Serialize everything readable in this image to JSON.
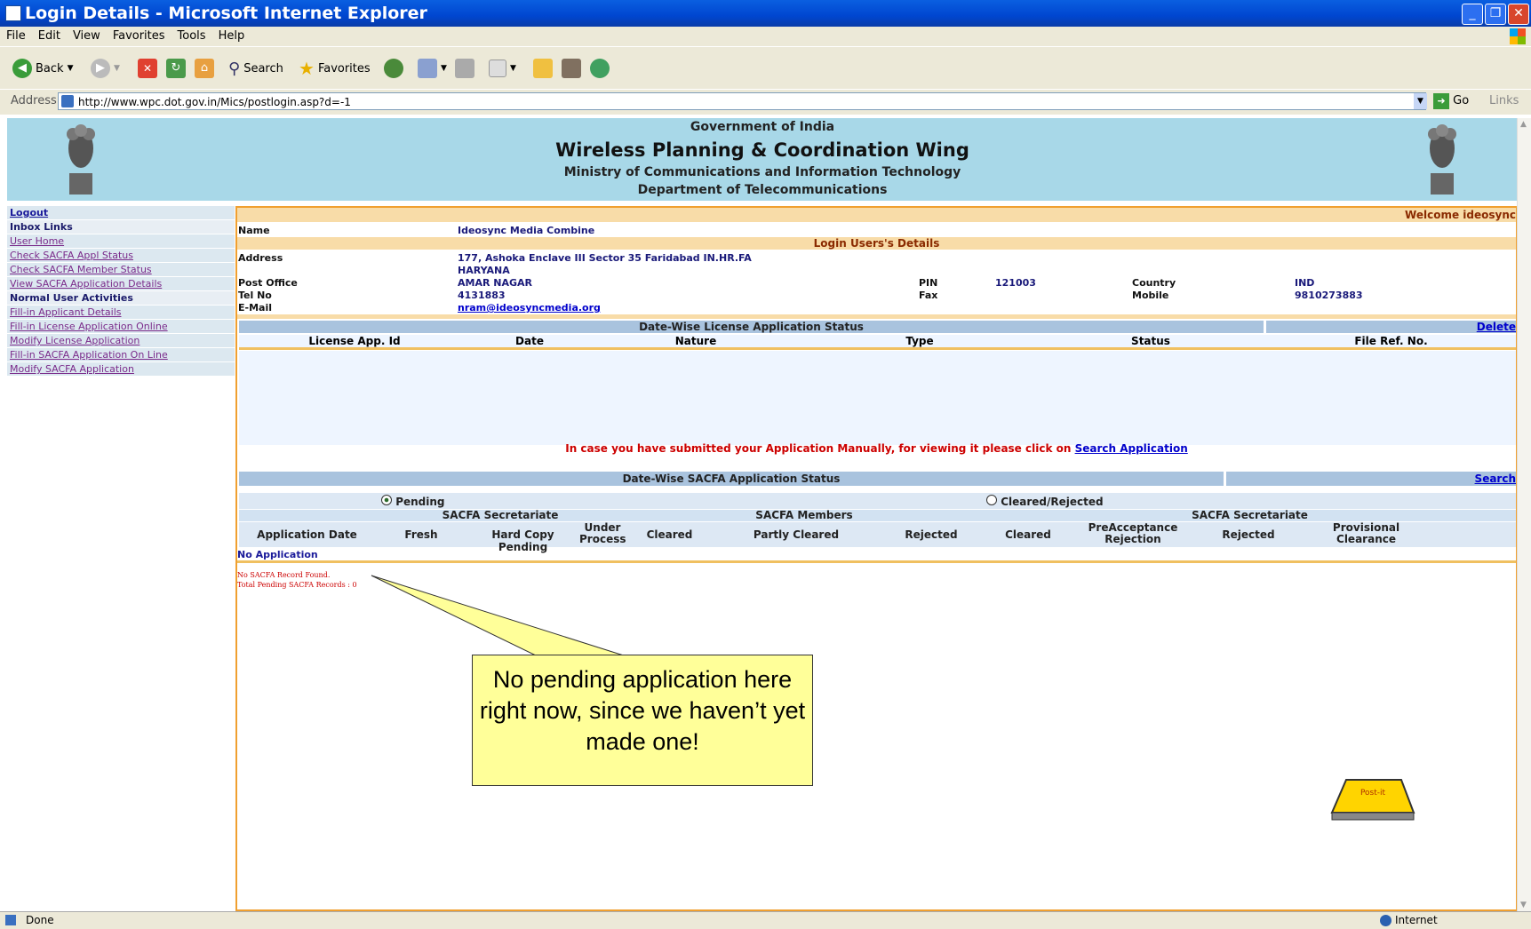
{
  "window": {
    "title": "Login Details - Microsoft Internet Explorer"
  },
  "menu": [
    "File",
    "Edit",
    "View",
    "Favorites",
    "Tools",
    "Help"
  ],
  "toolbar": {
    "back": "Back",
    "search": "Search",
    "favorites": "Favorites"
  },
  "address": {
    "label": "Address",
    "url": "http://www.wpc.dot.gov.in/Mics/postlogin.asp?d=-1",
    "go": "Go",
    "links": "Links"
  },
  "header": {
    "line1": "Government of India",
    "line2": "Wireless Planning & Coordination Wing",
    "line3": "Ministry of Communications and Information Technology",
    "line4": "Department of Telecommunications"
  },
  "sidebar": [
    {
      "label": "Logout",
      "type": "link"
    },
    {
      "label": "Inbox Links",
      "type": "head"
    },
    {
      "label": "User Home",
      "type": "link"
    },
    {
      "label": "Check SACFA Appl Status",
      "type": "link"
    },
    {
      "label": "Check SACFA Member Status",
      "type": "link"
    },
    {
      "label": "View SACFA Application Details",
      "type": "link"
    },
    {
      "label": "Normal User Activities",
      "type": "head"
    },
    {
      "label": "Fill-in Applicant Details",
      "type": "link"
    },
    {
      "label": "Fill-in License Application Online",
      "type": "link"
    },
    {
      "label": "Modify License Application",
      "type": "link"
    },
    {
      "label": "Fill-in SACFA Application On Line",
      "type": "link"
    },
    {
      "label": "Modify SACFA Application",
      "type": "link"
    }
  ],
  "welcome": "Welcome ideosync",
  "details": {
    "name_label": "Name",
    "name": "Ideosync Media Combine",
    "section_title": "Login Users's Details",
    "address_label": "Address",
    "address1": "177, Ashoka Enclave III  Sector 35  Faridabad  IN.HR.FA",
    "address2": "HARYANA",
    "po_label": "Post Office",
    "po": "AMAR NAGAR",
    "pin_label": "PIN",
    "pin": "121003",
    "country_label": "Country",
    "country": "IND",
    "tel_label": "Tel No",
    "tel": "4131883",
    "fax_label": "Fax",
    "mobile_label": "Mobile",
    "mobile": "9810273883",
    "email_label": "E-Mail",
    "email": "nram@ideosyncmedia.org"
  },
  "license": {
    "title": "Date-Wise License Application Status",
    "delete": "Delete",
    "columns": [
      "License App. Id",
      "Date",
      "Nature",
      "Type",
      "Status",
      "File Ref. No."
    ]
  },
  "manual_note": "In case you have submitted your Application Manually, for viewing it please click on ",
  "manual_link": "Search Application",
  "sacfa": {
    "title": "Date-Wise SACFA Application Status",
    "search": "Search",
    "pending": "Pending",
    "cleared": "Cleared/Rejected",
    "group1": "SACFA Secretariate",
    "group2": "SACFA Members",
    "group3": "SACFA Secretariate",
    "col_date": "Application Date",
    "col_fresh": "Fresh",
    "col_hardcopy": "Hard Copy Pending",
    "col_under": "Under Process",
    "col_cleared1": "Cleared",
    "col_partly": "Partly Cleared",
    "col_rejected1": "Rejected",
    "col_cleared2": "Cleared",
    "col_preacc": "PreAcceptance Rejection",
    "col_rejected2": "Rejected",
    "col_prov": "Provisional Clearance",
    "no_app": "No Application",
    "no_record": "No SACFA Record Found.",
    "total": "Total Pending SACFA Records : 0"
  },
  "callout": "No pending application here right now, since we haven’t yet made one!",
  "postit": "Post-it",
  "status": {
    "left": "Done",
    "right": "Internet"
  }
}
